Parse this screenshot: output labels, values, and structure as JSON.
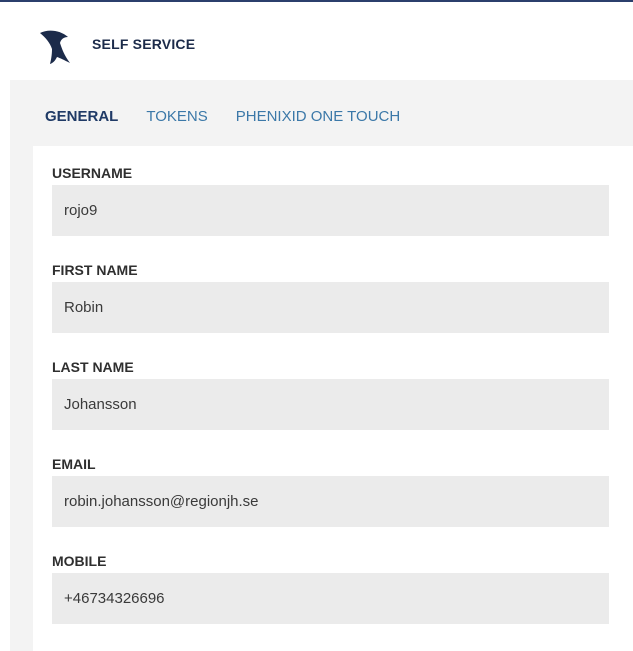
{
  "header": {
    "app_title": "SELF SERVICE",
    "logo_icon": "bird-logo-icon"
  },
  "tabs": [
    {
      "label": "GENERAL",
      "active": true
    },
    {
      "label": "TOKENS",
      "active": false
    },
    {
      "label": "PHENIXID ONE TOUCH",
      "active": false
    }
  ],
  "fields": {
    "username": {
      "label": "USERNAME",
      "value": "rojo9"
    },
    "first_name": {
      "label": "FIRST NAME",
      "value": "Robin"
    },
    "last_name": {
      "label": "LAST NAME",
      "value": "Johansson"
    },
    "email": {
      "label": "EMAIL",
      "value": "robin.johansson@regionjh.se"
    },
    "mobile": {
      "label": "MOBILE",
      "value": "+46734326696"
    }
  },
  "colors": {
    "header_rule": "#2b3f6c",
    "tab_active": "#1f3a66",
    "tab_inactive": "#3b78a8",
    "field_bg": "#ebebeb",
    "page_bg": "#f3f3f3"
  }
}
